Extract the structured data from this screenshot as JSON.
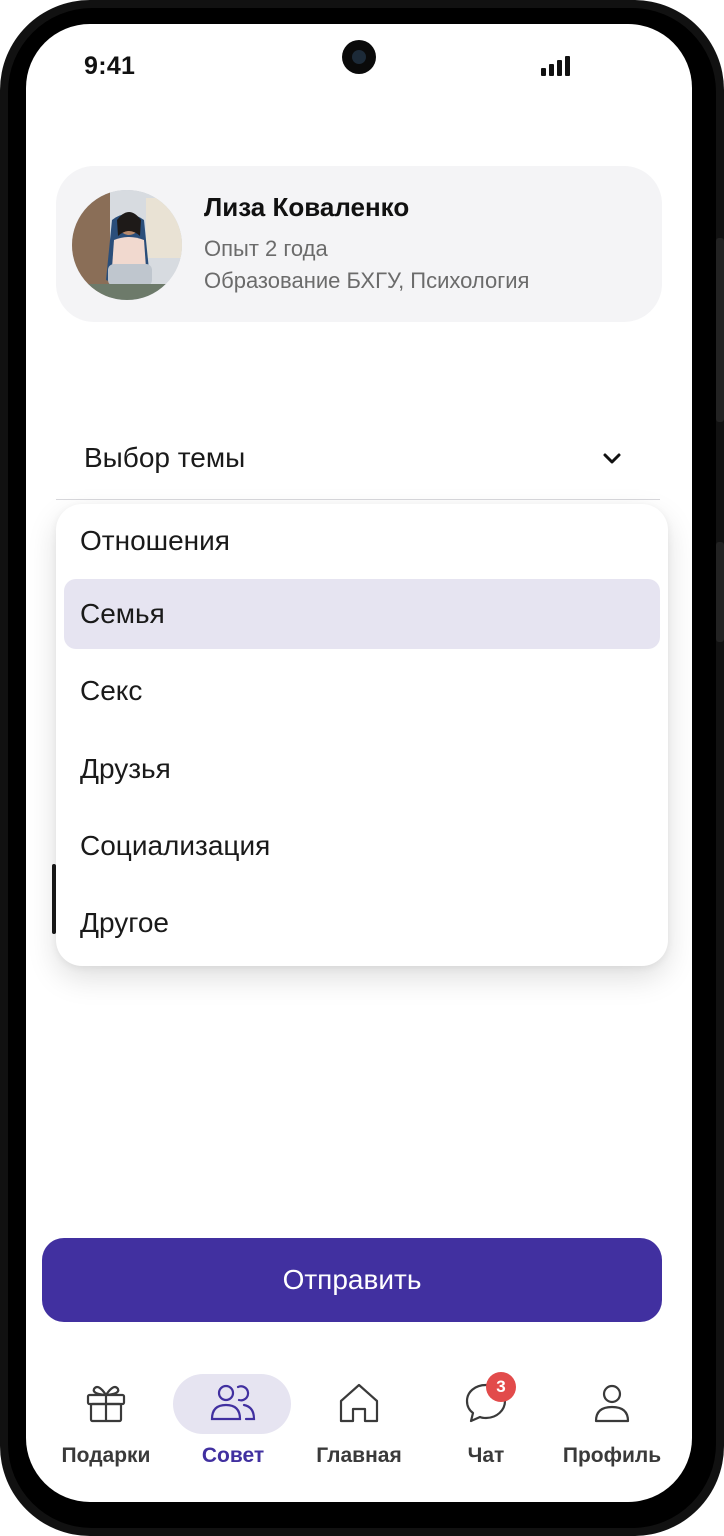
{
  "status_bar": {
    "time": "9:41"
  },
  "profile": {
    "name": "Лиза Коваленко",
    "experience": "Опыт  2 года",
    "education": "Образование  БХГУ, Психология"
  },
  "topic_select": {
    "label": "Выбор темы",
    "expanded": true,
    "options": [
      "Отношения",
      "Семья",
      "Секс",
      "Друзья",
      "Социализация",
      "Другое"
    ],
    "selected": "Семья"
  },
  "send_button": {
    "label": "Отправить"
  },
  "bottom_nav": {
    "items": [
      {
        "label": "Подарки",
        "icon": "gift-icon",
        "active": false
      },
      {
        "label": "Совет",
        "icon": "users-icon",
        "active": true
      },
      {
        "label": "Главная",
        "icon": "home-icon",
        "active": false
      },
      {
        "label": "Чат",
        "icon": "chat-icon",
        "active": false,
        "badge": "3"
      },
      {
        "label": "Профиль",
        "icon": "person-icon",
        "active": false
      }
    ]
  },
  "colors": {
    "accent": "#4130a0",
    "selected_bg": "#e6e4f1",
    "card_bg": "#f4f4f6",
    "badge": "#e24b4b"
  }
}
